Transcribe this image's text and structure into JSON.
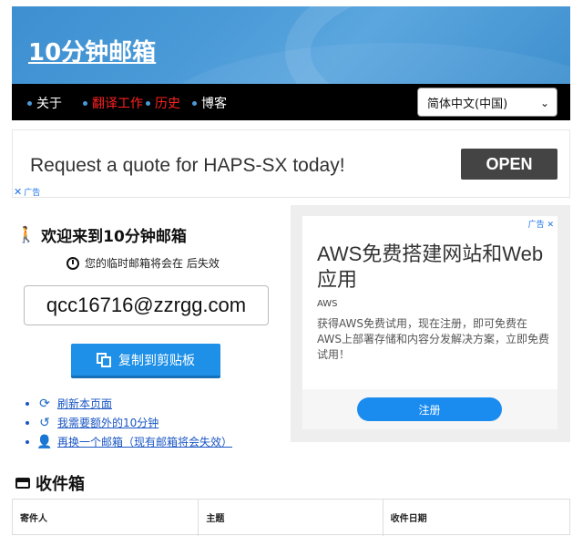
{
  "header": {
    "site_title": "10分钟邮箱"
  },
  "nav": {
    "items": [
      {
        "label": "关于",
        "color": "#ffffff"
      },
      {
        "label": "翻译工作",
        "color": "#ff2020"
      },
      {
        "label": "历史",
        "color": "#ff2020"
      },
      {
        "label": "博客",
        "color": "#ffffff"
      }
    ],
    "language": "简体中文(中国)"
  },
  "top_ad": {
    "text": "Request a quote for HAPS-SX today!",
    "button": "OPEN",
    "adchoices": "广告"
  },
  "mailbox": {
    "welcome": "欢迎来到10分钟邮箱",
    "expire_text": "您的临时邮箱将会在 后失效",
    "email": "qcc16716@zzrgg.com",
    "copy_button": "复制到剪贴板",
    "actions": [
      {
        "label": "刷新本页面",
        "icon": "refresh-icon"
      },
      {
        "label": "我需要额外的10分钟",
        "icon": "history-icon"
      },
      {
        "label": "再换一个邮箱（现有邮箱将会失效）",
        "icon": "user-icon"
      }
    ]
  },
  "side_ad": {
    "adchoices": "广告",
    "title": "AWS免费搭建网站和Web应用",
    "brand": "AWS",
    "description": "获得AWS免费试用，现在注册，即可免费在AWS上部署存储和内容分发解决方案，立即免费试用！",
    "button": "注册"
  },
  "inbox": {
    "title": "收件箱",
    "columns": [
      "寄件人",
      "主题",
      "收件日期"
    ]
  },
  "colors": {
    "accent": "#1e90e8",
    "banner": "#4a9ad8",
    "nav_bg": "#000000"
  }
}
